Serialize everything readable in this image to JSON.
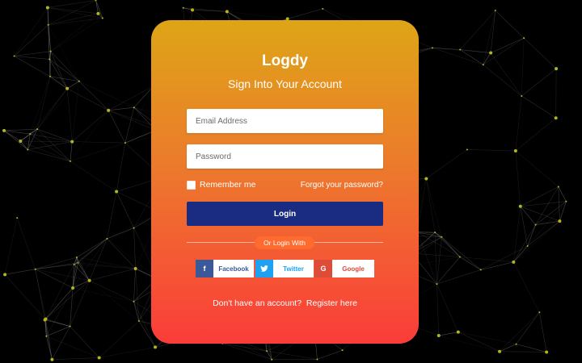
{
  "brand": "Logdy",
  "subtitle": "Sign Into Your Account",
  "form": {
    "email_placeholder": "Email Address",
    "password_placeholder": "Password",
    "remember_label": "Remember me",
    "forgot_label": "Forgot your password?",
    "login_label": "Login"
  },
  "social": {
    "divider_label": "Or Login With",
    "facebook": {
      "icon": "f",
      "label": "Facebook"
    },
    "twitter": {
      "icon": "twitter-bird",
      "label": "Twitter"
    },
    "google": {
      "icon": "G",
      "label": "Google"
    }
  },
  "footer": {
    "prompt": "Don't have an account?",
    "register_label": "Register here"
  },
  "colors": {
    "background": "#000000",
    "card_top": "#dea516",
    "card_bottom": "#fb3c3a",
    "login_button": "#1a2b82",
    "facebook": "#3b5998",
    "twitter": "#1da1f2",
    "google": "#dd4b39",
    "node": "#b4b41e"
  }
}
